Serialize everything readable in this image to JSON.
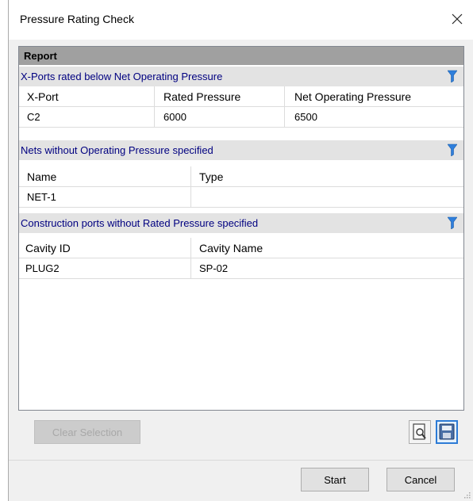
{
  "window": {
    "title": "Pressure Rating Check"
  },
  "report": {
    "header": "Report",
    "sections": [
      {
        "title": "X-Ports rated below Net Operating Pressure",
        "columns": [
          "X-Port",
          "Rated Pressure",
          "Net Operating Pressure"
        ],
        "rows": [
          [
            "C2",
            "6000",
            "6500"
          ]
        ]
      },
      {
        "title": "Nets without Operating Pressure specified",
        "columns": [
          "Name",
          "Type"
        ],
        "rows": [
          [
            "NET-1",
            ""
          ]
        ]
      },
      {
        "title": "Construction ports without Rated Pressure specified",
        "columns": [
          "Cavity ID",
          "Cavity Name"
        ],
        "rows": [
          [
            "PLUG2",
            "SP-02"
          ]
        ]
      }
    ]
  },
  "toolbar": {
    "clear_selection_label": "Clear Selection",
    "preview_icon": "print-preview-icon",
    "save_icon": "save-icon"
  },
  "buttons": {
    "start_label": "Start",
    "cancel_label": "Cancel"
  },
  "colors": {
    "section_title_text": "#000080",
    "report_header_bg": "#a0a0a0",
    "section_title_bg": "#e3e3e3",
    "filter_icon": "#2f7fdc"
  }
}
